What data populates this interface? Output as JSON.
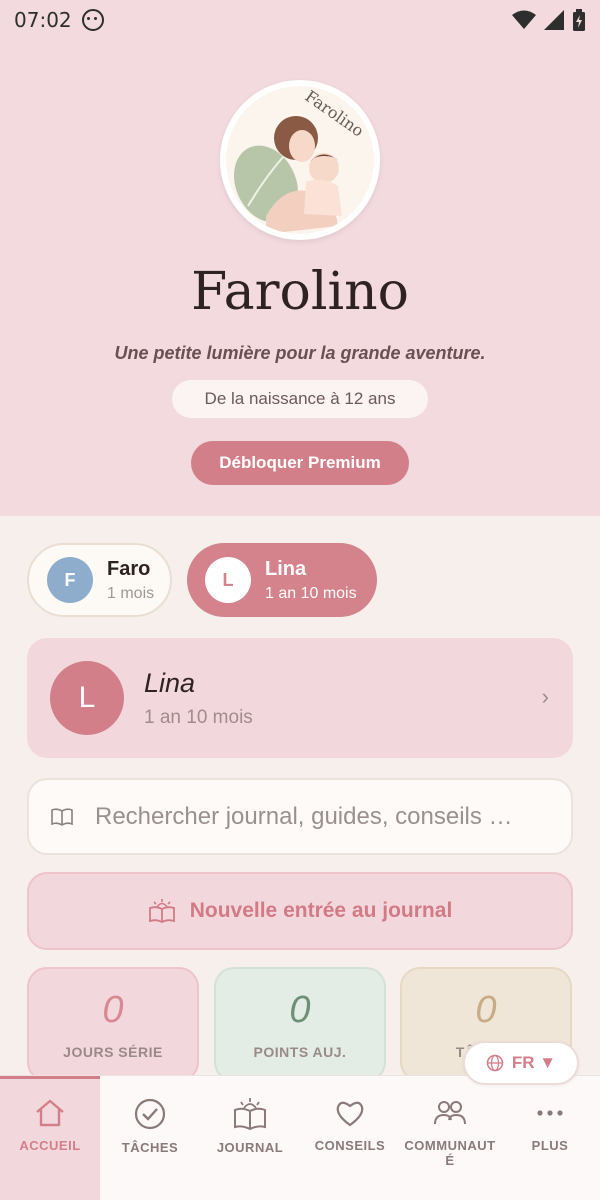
{
  "status_bar": {
    "time": "07:02"
  },
  "hero": {
    "logo_text": "Farolino",
    "title": "Farolino",
    "tagline": "Une petite lumière pour la grande aventure.",
    "age_range": "De la naissance à 12 ans",
    "premium_button": "Débloquer Premium"
  },
  "children": [
    {
      "initial": "F",
      "name": "Faro",
      "age": "1 mois",
      "selected": false
    },
    {
      "initial": "L",
      "name": "Lina",
      "age": "1 an 10 mois",
      "selected": true
    }
  ],
  "profile": {
    "initial": "L",
    "name": "Lina",
    "age": "1 an 10 mois"
  },
  "search": {
    "placeholder": "Rechercher journal, guides, conseils …"
  },
  "new_entry": {
    "label": "Nouvelle entrée au journal"
  },
  "stats": [
    {
      "value": "0",
      "label": "JOURS SÉRIE"
    },
    {
      "value": "0",
      "label": "POINTS AUJ."
    },
    {
      "value": "0",
      "label": "TÂCHES"
    }
  ],
  "language": {
    "label": "FR ▼"
  },
  "nav": [
    {
      "label": "ACCUEIL",
      "icon": "home-icon",
      "active": true
    },
    {
      "label": "TÂCHES",
      "icon": "check-circle-icon",
      "active": false
    },
    {
      "label": "JOURNAL",
      "icon": "journal-icon",
      "active": false
    },
    {
      "label": "CONSEILS",
      "icon": "heart-icon",
      "active": false
    },
    {
      "label": "COMMUNAUTÉ",
      "icon": "community-icon",
      "active": false
    },
    {
      "label": "PLUS",
      "icon": "more-icon",
      "active": false
    }
  ],
  "colors": {
    "accent": "#d27f89",
    "hero_bg": "#f2dadf",
    "page_bg": "#f7efec"
  }
}
